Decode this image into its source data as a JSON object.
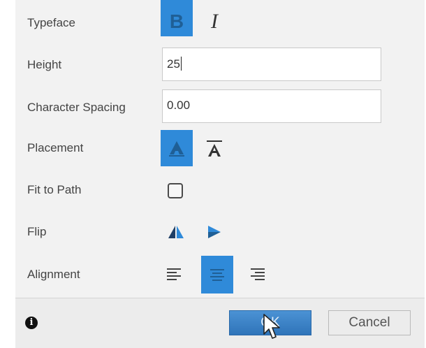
{
  "rows": {
    "typeface": {
      "label": "Typeface",
      "bold_glyph": "B",
      "italic_glyph": "I"
    },
    "height": {
      "label": "Height",
      "value": "25"
    },
    "character_spacing": {
      "label": "Character Spacing",
      "value": "0.00"
    },
    "placement": {
      "label": "Placement",
      "glyph": "A"
    },
    "fit_to_path": {
      "label": "Fit to Path",
      "checked": false
    },
    "flip": {
      "label": "Flip"
    },
    "alignment": {
      "label": "Alignment",
      "selected": "center"
    }
  },
  "footer": {
    "info_glyph": "i",
    "ok_label": "OK",
    "cancel_label": "Cancel"
  },
  "colors": {
    "accent": "#2f8ad9",
    "panel_bg": "#f2f2f2",
    "ok_button": "#3a82c6"
  },
  "icons": [
    "bold-icon",
    "italic-icon",
    "placement-above-icon",
    "placement-below-icon",
    "flip-horizontal-icon",
    "flip-vertical-icon",
    "align-left-icon",
    "align-center-icon",
    "align-right-icon",
    "info-icon",
    "mouse-cursor-icon"
  ]
}
